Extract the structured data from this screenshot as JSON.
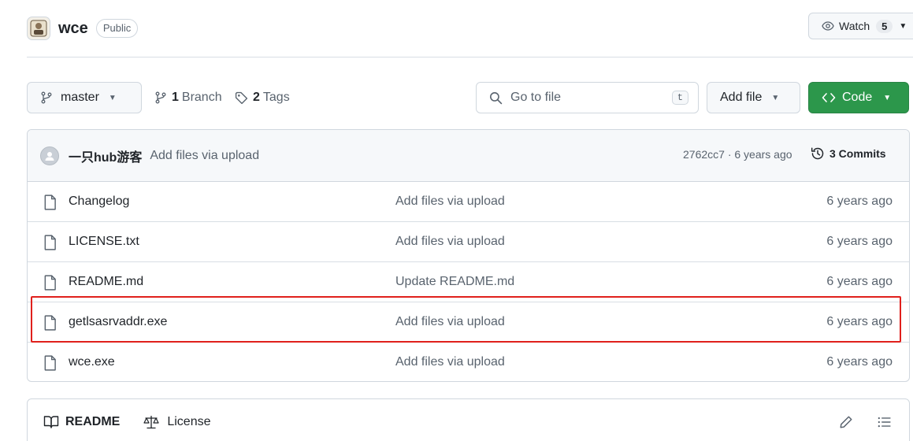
{
  "repo": {
    "name": "wce",
    "visibility": "Public"
  },
  "watch": {
    "label": "Watch",
    "count": "5"
  },
  "toolbar": {
    "branch": "master",
    "branches_count": "1",
    "branches_label": "Branch",
    "tags_count": "2",
    "tags_label": "Tags",
    "search_placeholder": "Go to file",
    "search_shortcut": "t",
    "add_file_label": "Add file",
    "code_label": "Code"
  },
  "latest_commit": {
    "author": "一只hub游客",
    "message": "Add files via upload",
    "sha_time": "2762cc7 · 6 years ago",
    "commits_label": "3 Commits"
  },
  "files": [
    {
      "name": "Changelog",
      "commit": "Add files via upload",
      "date": "6 years ago"
    },
    {
      "name": "LICENSE.txt",
      "commit": "Add files via upload",
      "date": "6 years ago"
    },
    {
      "name": "README.md",
      "commit": "Update README.md",
      "date": "6 years ago"
    },
    {
      "name": "getlsasrvaddr.exe",
      "commit": "Add files via upload",
      "date": "6 years ago"
    },
    {
      "name": "wce.exe",
      "commit": "Add files via upload",
      "date": "6 years ago"
    }
  ],
  "readme_bar": {
    "readme_label": "README",
    "license_label": "License"
  },
  "colors": {
    "accent_green": "#2c974b",
    "highlight_red": "#e0201c"
  }
}
